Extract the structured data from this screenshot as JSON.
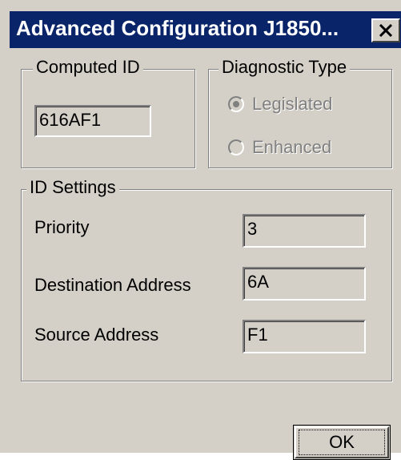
{
  "window": {
    "title": "Advanced Configuration J1850...",
    "close_glyph": "✕"
  },
  "computed_id": {
    "legend": "Computed ID",
    "value": "616AF1"
  },
  "diagnostic_type": {
    "legend": "Diagnostic Type",
    "options": [
      {
        "label": "Legislated",
        "selected": true,
        "enabled": false
      },
      {
        "label": "Enhanced",
        "selected": false,
        "enabled": false
      }
    ]
  },
  "id_settings": {
    "legend": "ID Settings",
    "priority_label": "Priority",
    "priority_value": "3",
    "destination_label": "Destination Address",
    "destination_value": "6A",
    "source_label": "Source Address",
    "source_value": "F1"
  },
  "buttons": {
    "ok_label": "OK"
  },
  "colors": {
    "titlebar": "#0a246a",
    "face": "#d4d0c8",
    "disabled_text": "#808080"
  }
}
